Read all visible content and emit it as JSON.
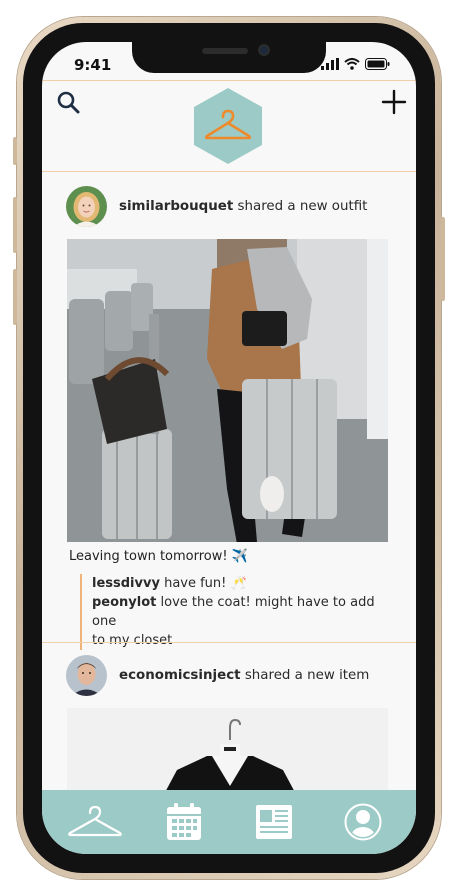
{
  "device": {
    "status_time": "9:41"
  },
  "header": {
    "search_icon": "search-icon",
    "add_icon": "plus-icon",
    "logo_icon": "hanger-icon",
    "logo_colors": {
      "hexagon": "#9ccac6",
      "hanger": "#ee8a2a"
    }
  },
  "feed": {
    "posts": [
      {
        "user": "similarbouquet",
        "action": "shared a new outfit",
        "caption": "Leaving town tomorrow! ✈️",
        "comments": [
          {
            "user": "lessdivvy",
            "text": "have fun! 🥂"
          },
          {
            "user": "peonylot",
            "text": "love the coat! might have to add one"
          },
          {
            "user": "",
            "text": "to my closet"
          }
        ]
      },
      {
        "user": "economicsinject",
        "action": "shared a new item",
        "caption": "",
        "comments": []
      }
    ]
  },
  "tabbar": {
    "background": "#9ccac6",
    "items": [
      {
        "icon": "hanger-icon"
      },
      {
        "icon": "calendar-icon"
      },
      {
        "icon": "news-icon"
      },
      {
        "icon": "profile-icon"
      }
    ]
  }
}
